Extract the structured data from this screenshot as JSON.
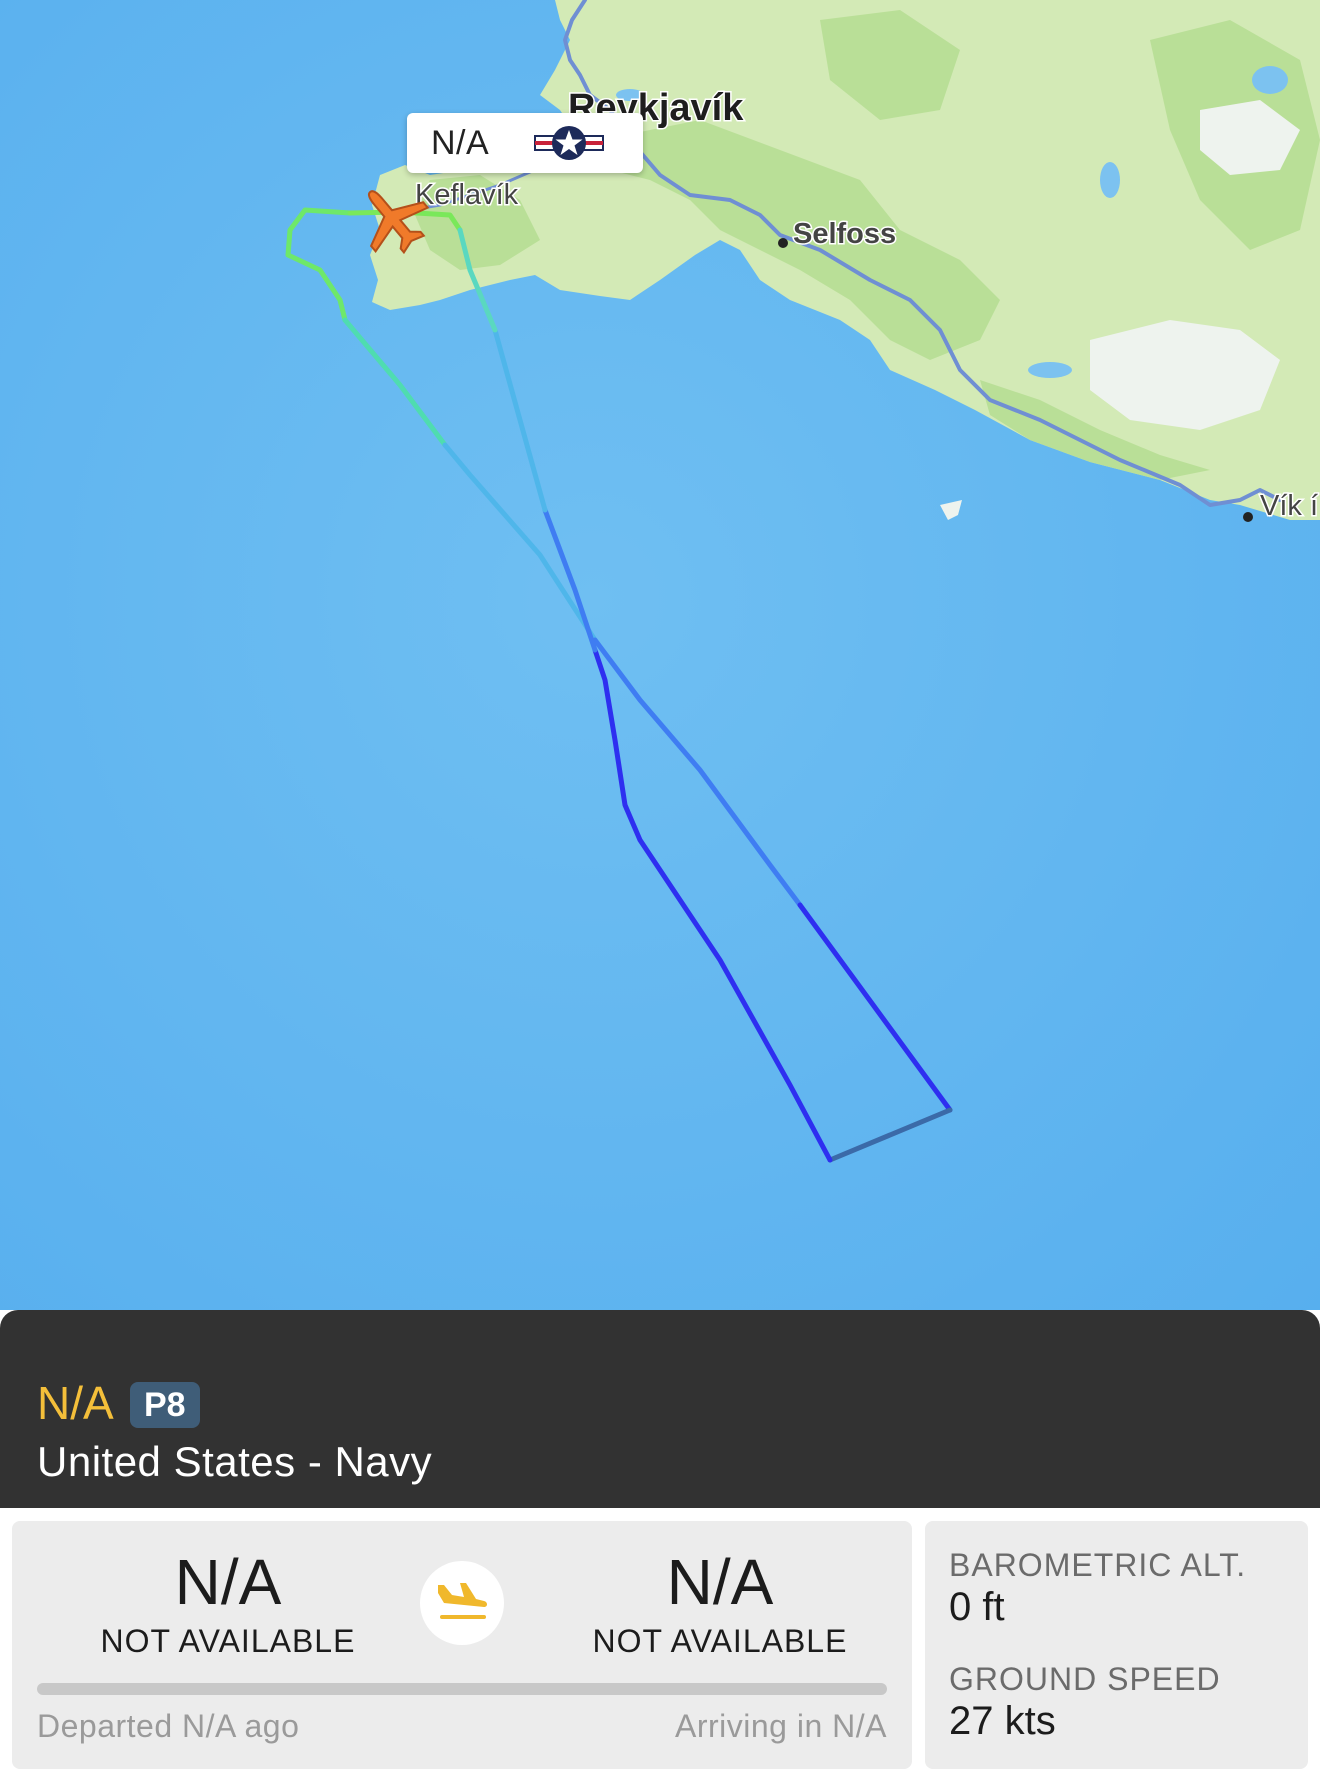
{
  "map": {
    "places": [
      "Reykjavík",
      "Keflavík",
      "Selfoss",
      "Vík í"
    ],
    "callout": {
      "registration": "N/A",
      "icon": "us-navy-roundel-icon"
    },
    "aircraft_icon": "airplane-icon",
    "colors": {
      "sea": "#5db3ef",
      "land": "#cfe8b0",
      "aircraft": "#f07a2a"
    }
  },
  "flight": {
    "callsign": "N/A",
    "aircraft_type": "P8",
    "operator": "United States - Navy"
  },
  "route": {
    "departure": {
      "code": "N/A",
      "name": "NOT AVAILABLE",
      "time_text": "Departed N/A ago"
    },
    "arrival": {
      "code": "N/A",
      "name": "NOT AVAILABLE",
      "time_text": "Arriving in N/A"
    },
    "status_icon": "landing-plane-icon"
  },
  "stats": {
    "altitude_label": "BAROMETRIC ALT.",
    "altitude_value": "0 ft",
    "speed_label": "GROUND SPEED",
    "speed_value": "27 kts"
  },
  "colors": {
    "callsign": "#f4bf3a",
    "badge": "#3f5d78",
    "header": "#323232",
    "card": "#ececec"
  }
}
